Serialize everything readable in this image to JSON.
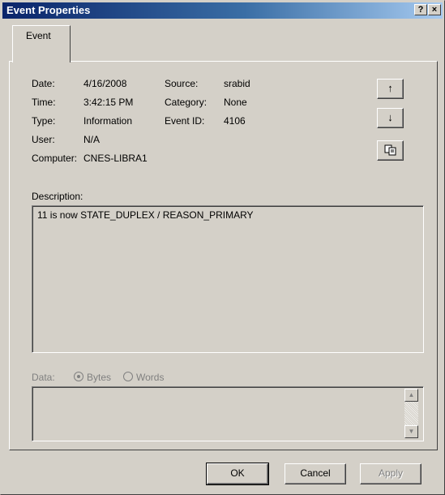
{
  "window": {
    "title": "Event Properties",
    "help_glyph": "?",
    "close_glyph": "×"
  },
  "tabs": [
    {
      "label": "Event"
    }
  ],
  "event": {
    "date_label": "Date:",
    "date_value": "4/16/2008",
    "time_label": "Time:",
    "time_value": "3:42:15 PM",
    "type_label": "Type:",
    "type_value": "Information",
    "user_label": "User:",
    "user_value": "N/A",
    "computer_label": "Computer:",
    "computer_value": "CNES-LIBRA1",
    "source_label": "Source:",
    "source_value": "srabid",
    "category_label": "Category:",
    "category_value": "None",
    "event_id_label": "Event ID:",
    "event_id_value": "4106"
  },
  "nav_buttons": {
    "up_glyph": "↑",
    "down_glyph": "↓",
    "copy_icon": "copy-icon"
  },
  "description": {
    "label": "Description:",
    "text": "11 is now STATE_DUPLEX / REASON_PRIMARY"
  },
  "data_section": {
    "label": "Data:",
    "bytes_label": "Bytes",
    "words_label": "Words",
    "selected": "Bytes"
  },
  "buttons": {
    "ok": "OK",
    "cancel": "Cancel",
    "apply": "Apply"
  }
}
